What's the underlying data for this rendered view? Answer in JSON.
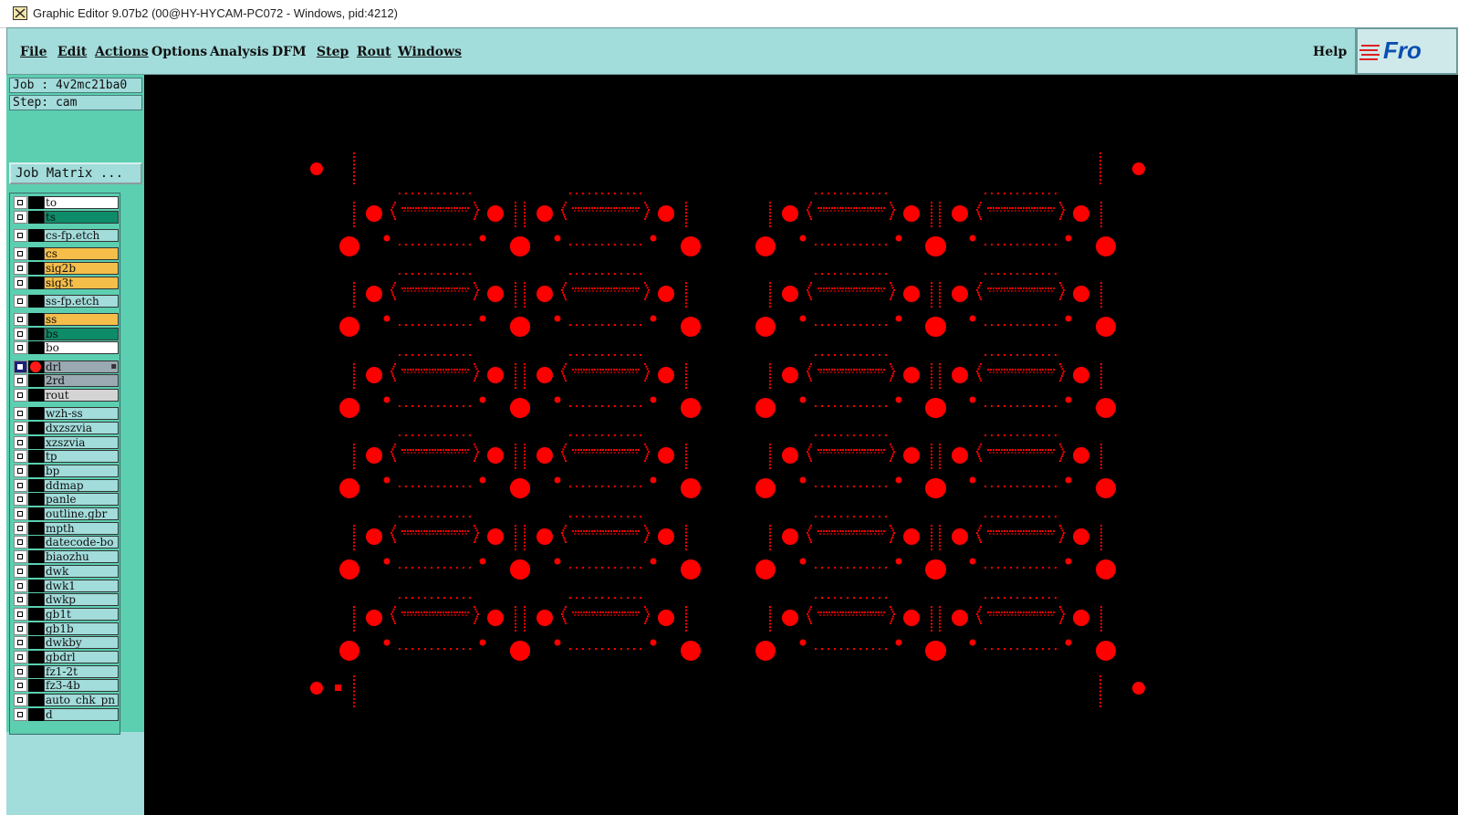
{
  "window": {
    "title": "Graphic Editor 9.07b2 (00@HY-HYCAM-PC072 - Windows, pid:4212)",
    "icon": "graphic-editor-app-icon"
  },
  "menubar": {
    "items": [
      {
        "label": "File"
      },
      {
        "label": "Edit"
      },
      {
        "label": "Actions"
      },
      {
        "label": "Options"
      },
      {
        "label": "Analysis"
      },
      {
        "label": "DFM"
      },
      {
        "label": "Step"
      },
      {
        "label": "Rout"
      },
      {
        "label": "Windows"
      }
    ],
    "help": "Help",
    "logo_text": "Fro"
  },
  "info": {
    "job": "Job : 4v2mc21ba0",
    "step": "Step: cam",
    "job_matrix": "Job Matrix ..."
  },
  "layers": [
    {
      "name": "to",
      "color": "#ffffff",
      "checked": false,
      "affected": false
    },
    {
      "name": "ts",
      "color": "#0e8c6a",
      "checked": false,
      "affected": false
    },
    {
      "name": "cs-fp.etch",
      "color": "#a2dcdb",
      "checked": false,
      "affected": false
    },
    {
      "name": "cs",
      "color": "#f5bd4a",
      "checked": false,
      "affected": false
    },
    {
      "name": "sig2b",
      "color": "#f5bd4a",
      "checked": false,
      "affected": false
    },
    {
      "name": "sig3t",
      "color": "#f5bd4a",
      "checked": false,
      "affected": false
    },
    {
      "name": "ss-fp.etch",
      "color": "#a2dcdb",
      "checked": false,
      "affected": false
    },
    {
      "name": "ss",
      "color": "#f5bd4a",
      "checked": false,
      "affected": false
    },
    {
      "name": "bs",
      "color": "#0e8c6a",
      "checked": false,
      "affected": false
    },
    {
      "name": "bo",
      "color": "#ffffff",
      "checked": false,
      "affected": false
    },
    {
      "name": "drl",
      "color": "#9aa9b2",
      "checked": true,
      "affected": true,
      "selected": true
    },
    {
      "name": "2rd",
      "color": "#9aa9b2",
      "checked": false,
      "affected": false
    },
    {
      "name": "rout",
      "color": "#d4d4d4",
      "checked": false,
      "affected": false
    },
    {
      "name": "wzh-ss",
      "color": "#a2dcdb",
      "checked": false,
      "affected": false
    },
    {
      "name": "dxzszvia",
      "color": "#a2dcdb",
      "checked": false,
      "affected": false
    },
    {
      "name": "xzszvia",
      "color": "#a2dcdb",
      "checked": false,
      "affected": false
    },
    {
      "name": "tp",
      "color": "#a2dcdb",
      "checked": false,
      "affected": false
    },
    {
      "name": "bp",
      "color": "#a2dcdb",
      "checked": false,
      "affected": false
    },
    {
      "name": "ddmap",
      "color": "#a2dcdb",
      "checked": false,
      "affected": false
    },
    {
      "name": "panle",
      "color": "#a2dcdb",
      "checked": false,
      "affected": false
    },
    {
      "name": "outline.gbr",
      "color": "#a2dcdb",
      "checked": false,
      "affected": false
    },
    {
      "name": "mpth",
      "color": "#a2dcdb",
      "checked": false,
      "affected": false
    },
    {
      "name": "datecode-bo",
      "color": "#a2dcdb",
      "checked": false,
      "affected": false
    },
    {
      "name": "biaozhu",
      "color": "#a2dcdb",
      "checked": false,
      "affected": false
    },
    {
      "name": "dwk",
      "color": "#a2dcdb",
      "checked": false,
      "affected": false
    },
    {
      "name": "dwk1",
      "color": "#a2dcdb",
      "checked": false,
      "affected": false
    },
    {
      "name": "dwkp",
      "color": "#a2dcdb",
      "checked": false,
      "affected": false
    },
    {
      "name": "gb1t",
      "color": "#a2dcdb",
      "checked": false,
      "affected": false
    },
    {
      "name": "gb1b",
      "color": "#a2dcdb",
      "checked": false,
      "affected": false
    },
    {
      "name": "dwkby",
      "color": "#a2dcdb",
      "checked": false,
      "affected": false
    },
    {
      "name": "gbdrl",
      "color": "#a2dcdb",
      "checked": false,
      "affected": false
    },
    {
      "name": "fz1-2t",
      "color": "#a2dcdb",
      "checked": false,
      "affected": false
    },
    {
      "name": "fz3-4b",
      "color": "#a2dcdb",
      "checked": false,
      "affected": false
    },
    {
      "name": "auto_chk_pn",
      "color": "#a2dcdb",
      "checked": false,
      "affected": false
    },
    {
      "name": "d",
      "color": "#a2dcdb",
      "checked": false,
      "affected": false
    }
  ],
  "canvas": {
    "background": "#000000",
    "feature_color": "#ff0000",
    "array_columns": 4,
    "array_rows": 6
  }
}
